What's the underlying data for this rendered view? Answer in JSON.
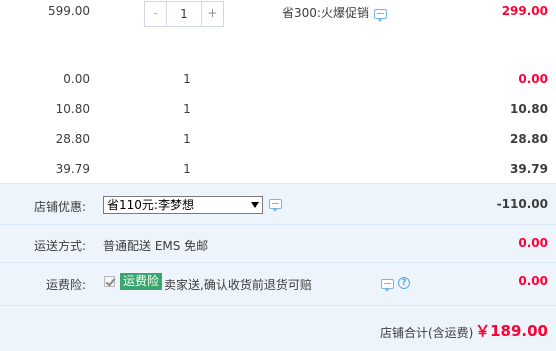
{
  "items": [
    {
      "price": "599.00",
      "qty": "1",
      "subtotal": "299.00",
      "promo": "省300:火爆促销",
      "has_stepper": true
    },
    {
      "price": "0.00",
      "qty": "1",
      "subtotal": "0.00"
    },
    {
      "price": "10.80",
      "qty": "1",
      "subtotal": "10.80"
    },
    {
      "price": "28.80",
      "qty": "1",
      "subtotal": "28.80"
    },
    {
      "price": "39.79",
      "qty": "1",
      "subtotal": "39.79"
    }
  ],
  "stepper": {
    "minus": "-",
    "plus": "+",
    "value": "1"
  },
  "store_discount": {
    "label": "店铺优惠:",
    "selected": "省110元:李梦想",
    "amount": "-110.00"
  },
  "shipping": {
    "label": "运送方式:",
    "method": "普通配送 EMS 免邮",
    "amount": "0.00"
  },
  "insurance": {
    "label": "运费险:",
    "tag": "运费险",
    "desc": "卖家送,确认收货前退货可赔",
    "amount": "0.00",
    "help": "?"
  },
  "total": {
    "label": "店铺合计(含运费)",
    "value": "￥189.00"
  },
  "colors": {
    "accent_red": "#ff0036",
    "panel_bg": "#eef4fb",
    "tag_green": "#3aa66b",
    "icon_blue": "#76b7e8"
  }
}
